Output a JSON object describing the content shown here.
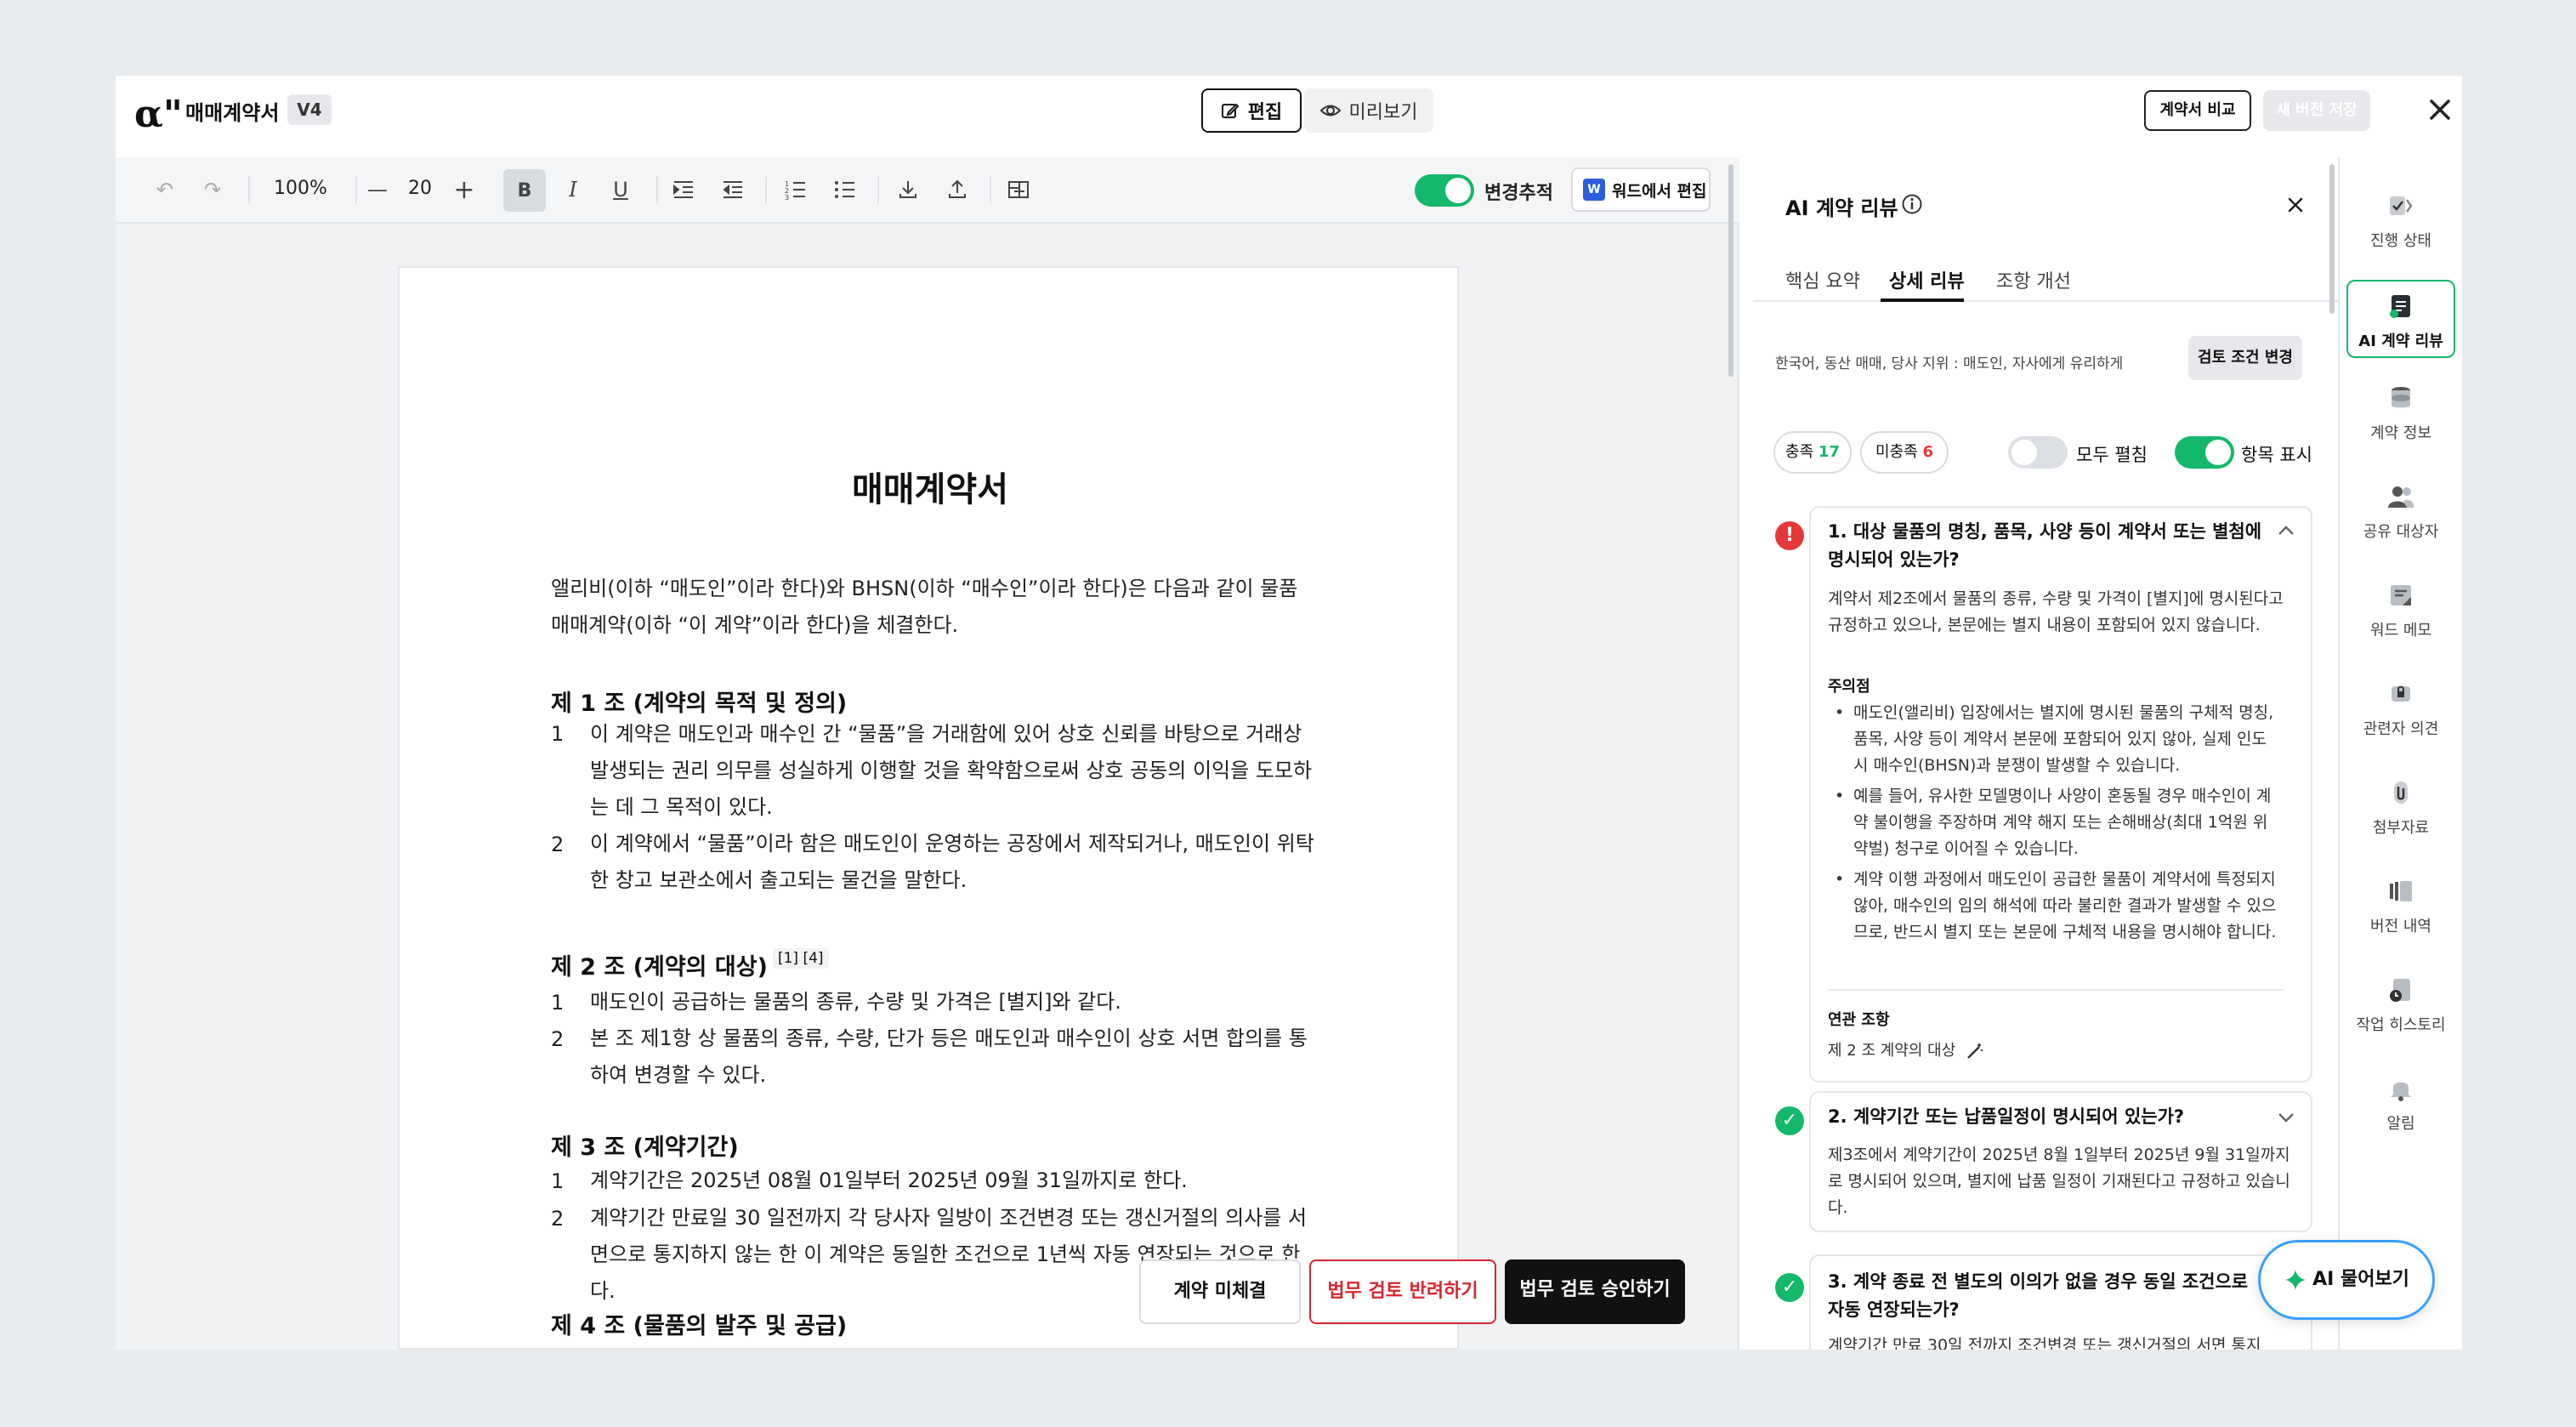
{
  "header": {
    "app_logo": "α\"",
    "title": "매매계약서",
    "version": "V4",
    "edit_label": "편집",
    "preview_label": "미리보기",
    "compare_label": "계약서 비교",
    "new_version_label": "새 버전 저장"
  },
  "toolbar": {
    "zoom": "100%",
    "font_size": "20",
    "track_changes_label": "변경추적",
    "word_edit_label": "워드에서 편집",
    "word_badge": "W"
  },
  "document": {
    "title": "매매계약서",
    "intro": "앨리비(이하 “매도인”이라 한다)와 BHSN(이하 “매수인”이라 한다)은 다음과 같이 물품 매매계약(이하 “이 계약”이라 한다)을 체결한다.",
    "art1": {
      "heading": "제 1 조 (계약의 목적 및 정의)",
      "items": [
        {
          "n": "1",
          "t": "이 계약은 매도인과 매수인 간 “물품”을 거래함에 있어 상호 신뢰를 바탕으로 거래상 발생되는 권리 의무를 성실하게 이행할 것을 확약함으로써 상호 공동의 이익을 도모하는 데 그 목적이 있다."
        },
        {
          "n": "2",
          "t": "이 계약에서 “물품”이라 함은 매도인이 운영하는 공장에서 제작되거나, 매도인이 위탁한 창고 보관소에서 출고되는 물건을 말한다."
        }
      ]
    },
    "art2": {
      "heading": "제 2 조 (계약의 대상)",
      "fn1": "[1]",
      "fn2": "[4]",
      "items": [
        {
          "n": "1",
          "t": "매도인이 공급하는 물품의 종류, 수량 및 가격은 [별지]와 같다."
        },
        {
          "n": "2",
          "t": "본 조 제1항 상 물품의 종류, 수량, 단가 등은 매도인과 매수인이 상호 서면 합의를 통하여 변경할 수 있다."
        }
      ]
    },
    "art3": {
      "heading": "제 3 조 (계약기간)",
      "items": [
        {
          "n": "1",
          "t": "계약기간은 2025년 08월 01일부터 2025년 09월 31일까지로 한다."
        },
        {
          "n": "2",
          "t": "계약기간 만료일 30 일전까지 각 당사자 일방이 조건변경 또는 갱신거절의 의사를 서면으로 통지하지 않는 한 이 계약은 동일한 조건으로 1년씩 자동 연장되는 것으로 한다."
        }
      ]
    },
    "art4": {
      "heading": "제 4 조 (물품의 발주 및 공급)"
    }
  },
  "footer_actions": {
    "not_signed": "계약 미체결",
    "reject": "법무 검토 반려하기",
    "approve": "법무 검토 승인하기"
  },
  "ai_review": {
    "title": "AI 계약 리뷰",
    "tabs": [
      "핵심 요약",
      "상세 리뷰",
      "조항 개선"
    ],
    "criteria": "한국어, 동산 매매, 당사 지위 : 매도인, 자사에게 유리하게",
    "change_criteria": "검토 조건 변경",
    "met_label": "충족",
    "met_count": "17",
    "unmet_label": "미충족",
    "unmet_count": "6",
    "expand_all": "모두 펼침",
    "show_items": "항목 표시",
    "cards": [
      {
        "title": "1. 대상 물품의 명칭, 품목, 사양 등이 계약서 또는 별첨에 명시되어 있는가?",
        "body": "계약서 제2조에서 물품의 종류, 수량 및 가격이 [별지]에 명시된다고 규정하고 있으나, 본문에는 별지 내용이 포함되어 있지 않습니다.",
        "caution": "주의점",
        "bullets": [
          "매도인(앨리비) 입장에서는 별지에 명시된 물품의 구체적 명칭, 품목, 사양 등이 계약서 본문에 포함되어 있지 않아, 실제 인도 시 매수인(BHSN)과 분쟁이 발생할 수 있습니다.",
          "예를 들어, 유사한 모델명이나 사양이 혼동될 경우 매수인이 계약 불이행을 주장하며 계약 해지 또는 손해배상(최대 1억원 위약벌) 청구로 이어질 수 있습니다.",
          "계약 이행 과정에서 매도인이 공급한 물품이 계약서에 특정되지 않아, 매수인의 임의 해석에 따라 불리한 결과가 발생할 수 있으므로, 반드시 별지 또는 본문에 구체적 내용을 명시해야 합니다."
        ],
        "related_label": "연관 조항",
        "related": "제 2 조 계약의 대상"
      },
      {
        "title": "2. 계약기간 또는 납품일정이 명시되어 있는가?",
        "body": "제3조에서 계약기간이 2025년 8월 1일부터 2025년 9월 31일까지로 명시되어 있으며, 별지에 납품 일정이 기재된다고 규정하고 있습니다."
      },
      {
        "title": "3. 계약 종료 전 별도의 이의가 없을 경우 동일 조건으로 자동 연장되는가?",
        "body": "계약기간 만료 30일 전까지 조건변경 또는 갱신거절의 서면 통지"
      }
    ]
  },
  "rail": [
    "진행 상태",
    "AI 계약 리뷰",
    "계약 정보",
    "공유 대상자",
    "워드 메모",
    "관련자 의견",
    "첨부자료",
    "버전 내역",
    "작업 히스토리",
    "알림"
  ],
  "ask_ai": "AI 물어보기",
  "colors": {
    "accent_green": "#14b86b",
    "danger_red": "#e5383b",
    "approve_dark": "#111111",
    "reject_red": "#d7262e",
    "ask_border": "#3aa0ff"
  }
}
